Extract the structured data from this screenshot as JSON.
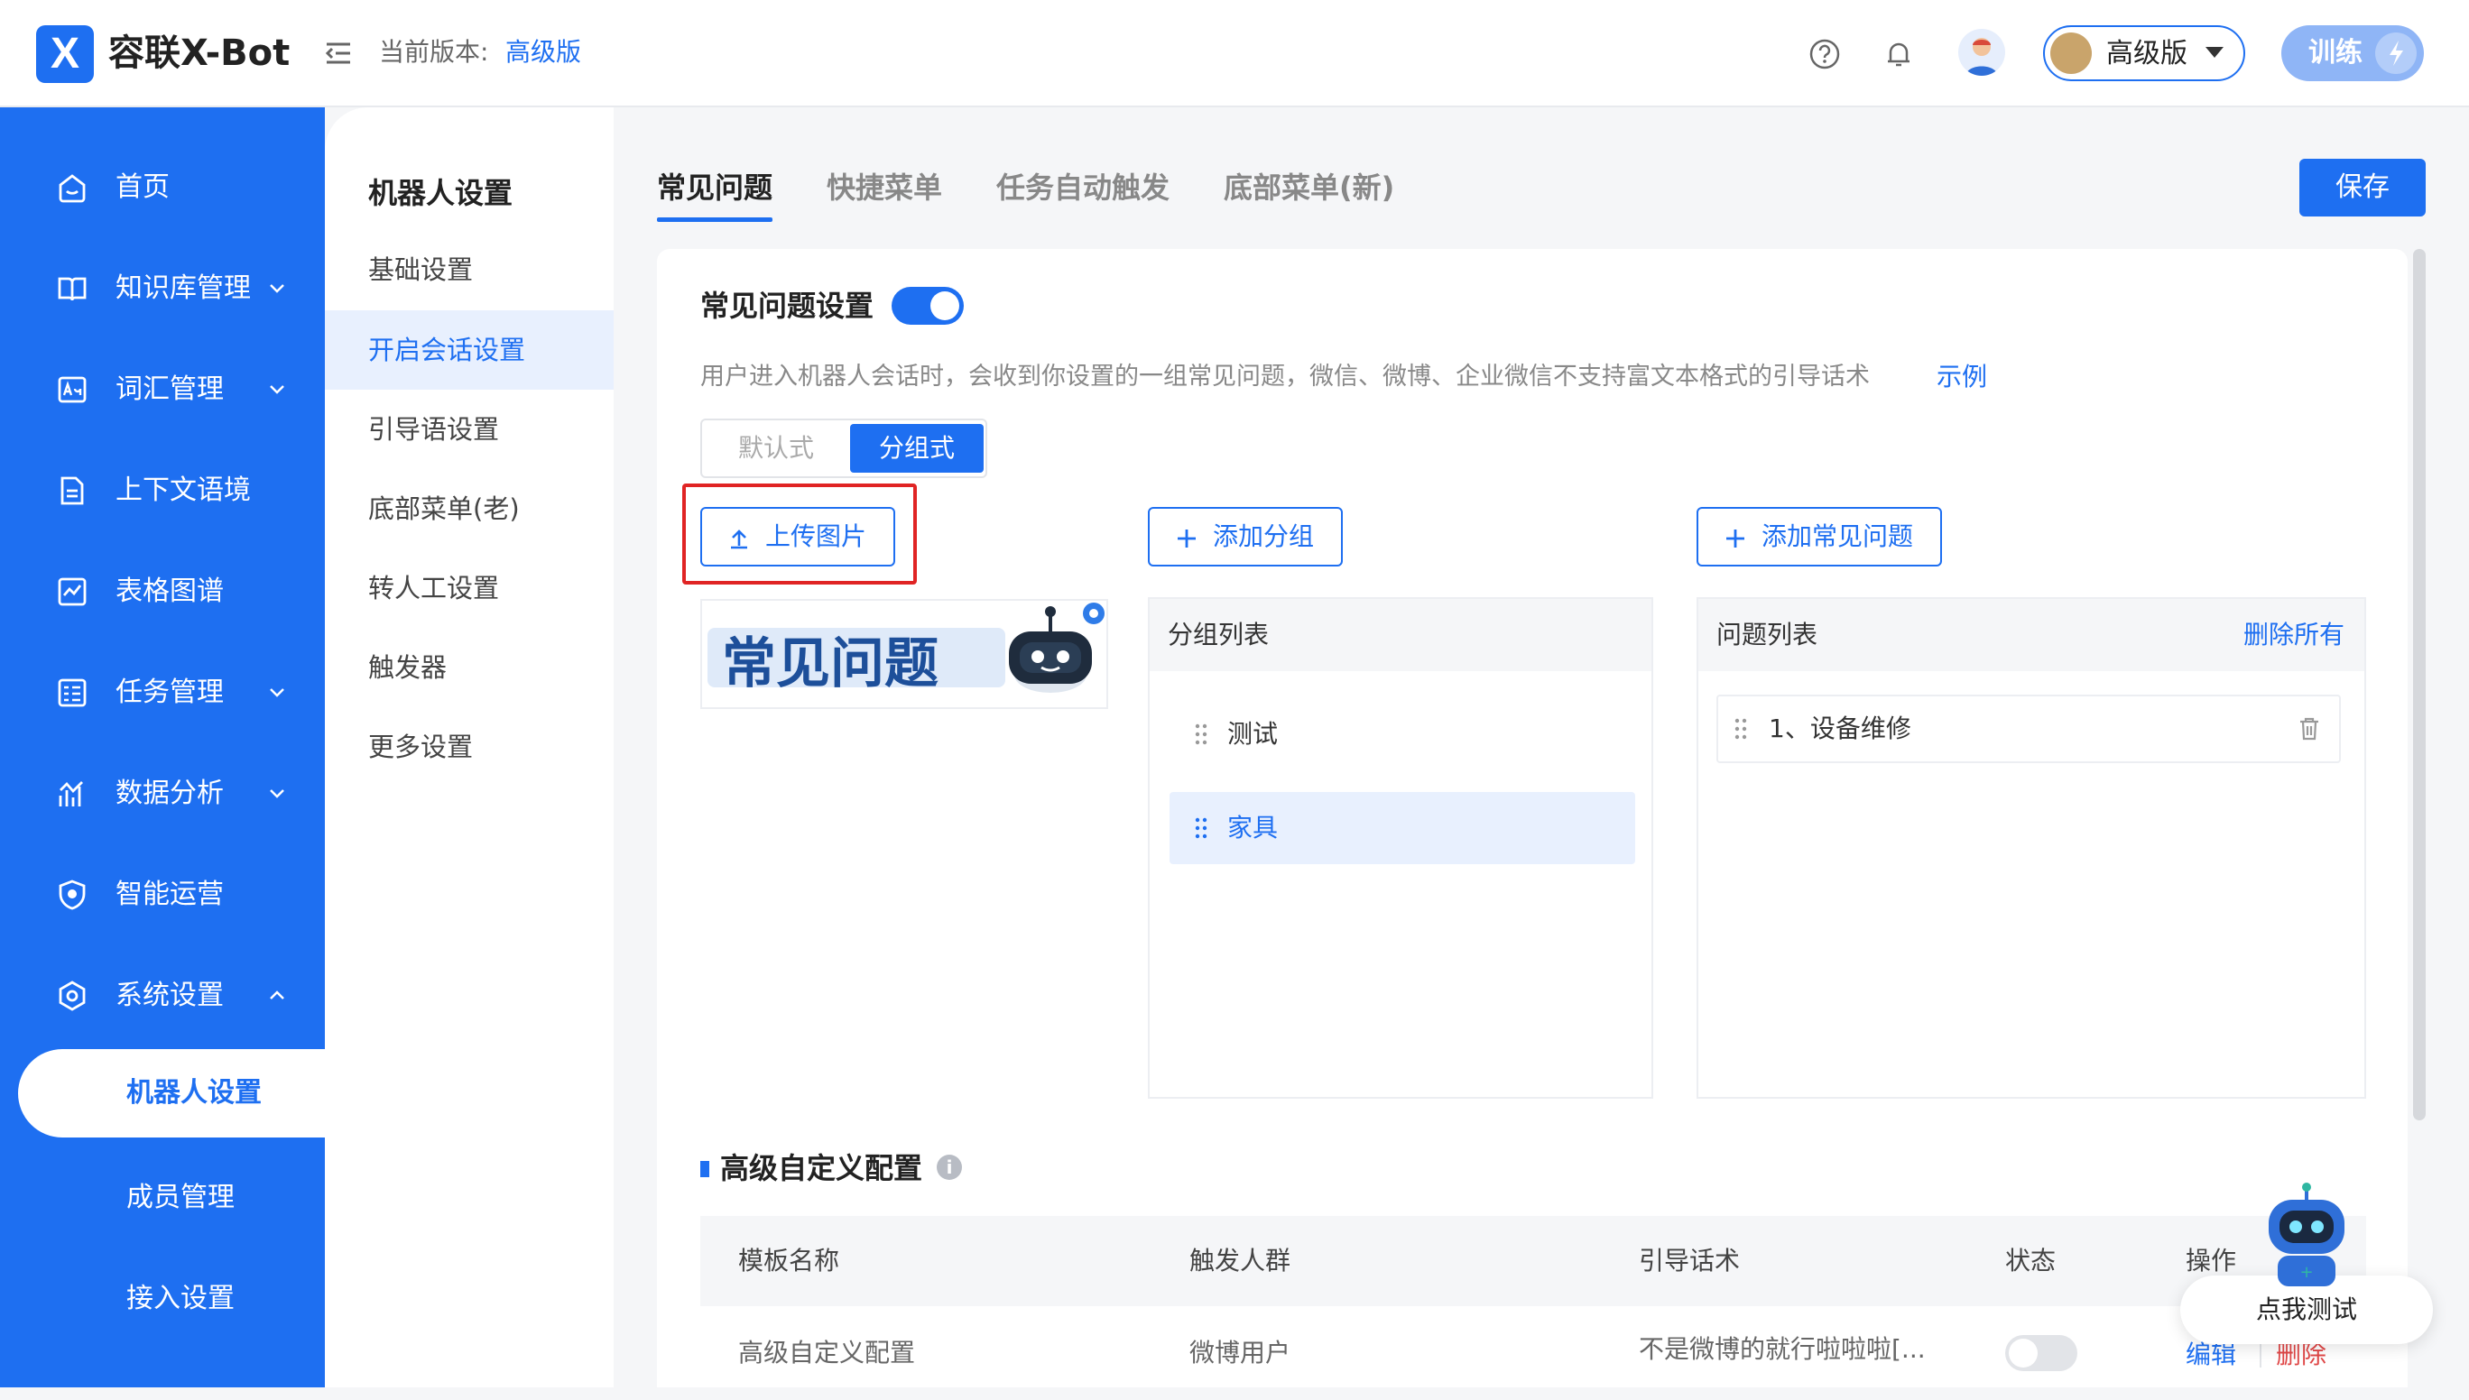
{
  "header": {
    "logo_letter": "X",
    "app_name": "容联X-Bot",
    "version_label": "当前版本:",
    "version_value": "高级版",
    "plan_label": "高级版",
    "train_label": "训练"
  },
  "sidebar": {
    "items": [
      {
        "label": "首页",
        "icon": "home-icon"
      },
      {
        "label": "知识库管理",
        "icon": "book-icon"
      },
      {
        "label": "词汇管理",
        "icon": "vocabulary-icon"
      },
      {
        "label": "上下文语境",
        "icon": "document-icon"
      },
      {
        "label": "表格图谱",
        "icon": "chart-icon"
      },
      {
        "label": "任务管理",
        "icon": "task-icon"
      },
      {
        "label": "数据分析",
        "icon": "analytics-icon"
      },
      {
        "label": "智能运营",
        "icon": "shield-icon"
      },
      {
        "label": "系统设置",
        "icon": "settings-icon"
      }
    ],
    "sub_items": [
      "机器人设置",
      "成员管理",
      "接入设置"
    ]
  },
  "subnav": {
    "title": "机器人设置",
    "items": [
      "基础设置",
      "开启会话设置",
      "引导语设置",
      "底部菜单(老)",
      "转人工设置",
      "触发器",
      "更多设置"
    ]
  },
  "tabs": [
    "常见问题",
    "快捷菜单",
    "任务自动触发",
    "底部菜单(新)"
  ],
  "save_label": "保存",
  "faq": {
    "title": "常见问题设置",
    "enabled": true,
    "description": "用户进入机器人会话时，会收到你设置的一组常见问题，微信、微博、企业微信不支持富文本格式的引导话术",
    "example_link": "示例",
    "mode_default": "默认式",
    "mode_grouped": "分组式",
    "upload_label": "上传图片",
    "add_group_label": "添加分组",
    "add_question_label": "添加常见问题",
    "preview_text": "常见问题",
    "group_list": {
      "title": "分组列表",
      "items": [
        "测试",
        "家具"
      ],
      "selected_index": 1
    },
    "question_list": {
      "title": "问题列表",
      "delete_all": "删除所有",
      "items": [
        "1、设备维修"
      ]
    }
  },
  "advanced": {
    "title": "高级自定义配置",
    "info": "i",
    "columns": [
      "模板名称",
      "触发人群",
      "引导话术",
      "状态",
      "操作"
    ],
    "rows": [
      {
        "name": "高级自定义配置",
        "audience": "微博用户",
        "script": "不是微博的就行啦啦啦[...",
        "status_on": false,
        "edit": "编辑",
        "delete": "删除"
      }
    ]
  },
  "test_button_label": "点我测试",
  "colors": {
    "primary": "#1e6ff1",
    "highlight": "#e02424"
  }
}
